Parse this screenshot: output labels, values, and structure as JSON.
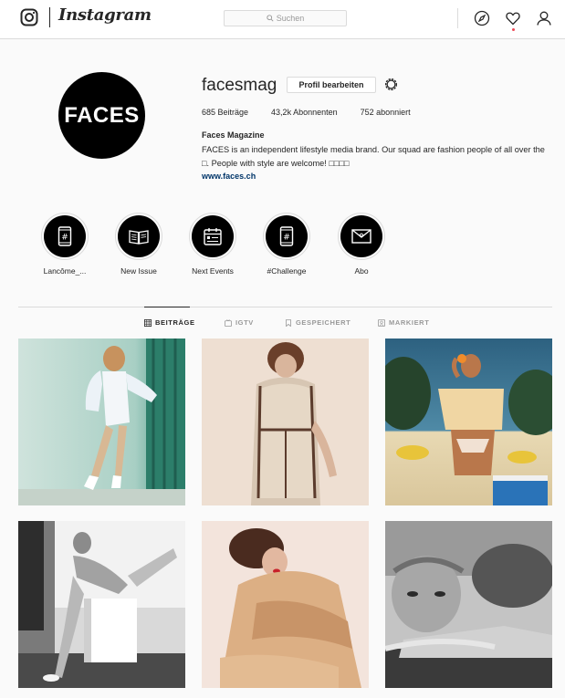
{
  "nav": {
    "wordmark": "Instagram",
    "search_placeholder": "Suchen",
    "icons": [
      "instagram-glyph-icon",
      "search-icon",
      "compass-icon",
      "heart-icon",
      "user-icon"
    ],
    "notification_color": "#ed4956"
  },
  "profile": {
    "avatar_text": "FACES",
    "username": "facesmag",
    "edit_label": "Profil bearbeiten",
    "stats": {
      "posts": "685 Beiträge",
      "followers": "43,2k Abonnenten",
      "following": "752 abonniert"
    },
    "bio_name": "Faces Magazine",
    "bio_text": "FACES is an independent lifestyle media brand. Our squad are fashion people of all over the □. People with style are welcome! □□□□",
    "bio_link": "www.faces.ch"
  },
  "highlights": [
    {
      "label": "Lancôme_...",
      "icon": "hashtag-phone-icon"
    },
    {
      "label": "New Issue",
      "icon": "open-magazine-icon"
    },
    {
      "label": "Next Events",
      "icon": "calendar-icon"
    },
    {
      "label": "#Challenge",
      "icon": "hashtag-phone-icon"
    },
    {
      "label": "Abo",
      "icon": "envelope-icon"
    }
  ],
  "tabs": [
    {
      "label": "BEITRÄGE",
      "icon": "grid-icon",
      "active": true
    },
    {
      "label": "IGTV",
      "icon": "igtv-icon",
      "active": false
    },
    {
      "label": "GESPEICHERT",
      "icon": "bookmark-icon",
      "active": false
    },
    {
      "label": "MARKIERT",
      "icon": "tagged-icon",
      "active": false
    }
  ],
  "posts_count_shown": 6,
  "colors": {
    "text": "#262626",
    "muted": "#999999",
    "link": "#003569",
    "border": "#dbdbdb",
    "background": "#fafafa"
  }
}
